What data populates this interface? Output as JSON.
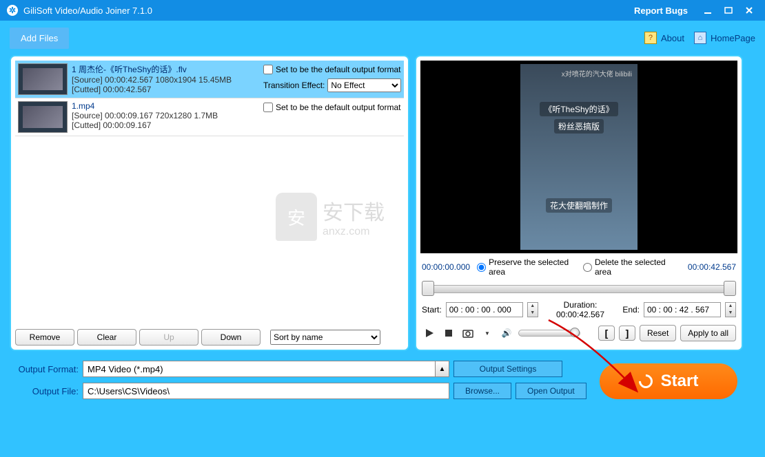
{
  "titlebar": {
    "title": "GiliSoft Video/Audio Joiner 7.1.0",
    "report": "Report Bugs"
  },
  "toolbar": {
    "addFiles": "Add Files",
    "about": "About",
    "homepage": "HomePage"
  },
  "files": [
    {
      "name": "1 周杰伦-《听TheShy的话》.flv",
      "source": "[Source]  00:00:42.567  1080x1904  15.45MB",
      "cutted": "[Cutted]  00:00:42.567",
      "defaultChk": "Set to be the default output format",
      "transLabel": "Transition Effect:",
      "transValue": "No Effect",
      "selected": true
    },
    {
      "name": "1.mp4",
      "source": "[Source]  00:00:09.167  720x1280  1.7MB",
      "cutted": "[Cutted]  00:00:09.167",
      "defaultChk": "Set to be the default output format",
      "selected": false
    }
  ],
  "listBtns": {
    "remove": "Remove",
    "clear": "Clear",
    "up": "Up",
    "down": "Down",
    "sortLabel": "Sort by name"
  },
  "preview": {
    "watermark": "x对喷花的汽大佬  bilibili",
    "line1": "《听TheShy的话》",
    "line2": "粉丝恶搞版",
    "line3": "花大使翻唱制作",
    "t0": "00:00:00.000",
    "t1": "00:00:42.567",
    "radPreserve": "Preserve the selected area",
    "radDelete": "Delete the selected area",
    "startLabel": "Start:",
    "startVal": "00 : 00 : 00 . 000",
    "durLabel": "Duration:",
    "durVal": "00:00:42.567",
    "endLabel": "End:",
    "endVal": "00 : 00 : 42 . 567",
    "reset": "Reset",
    "applyAll": "Apply to all"
  },
  "output": {
    "formatLabel": "Output Format:",
    "formatValue": "MP4 Video (*.mp4)",
    "settings": "Output Settings",
    "fileLabel": "Output File:",
    "fileValue": "C:\\Users\\CS\\Videos\\",
    "browse": "Browse...",
    "openOutput": "Open Output",
    "start": "Start"
  },
  "wm": {
    "cn": "安下载",
    "en": "anxz.com"
  }
}
